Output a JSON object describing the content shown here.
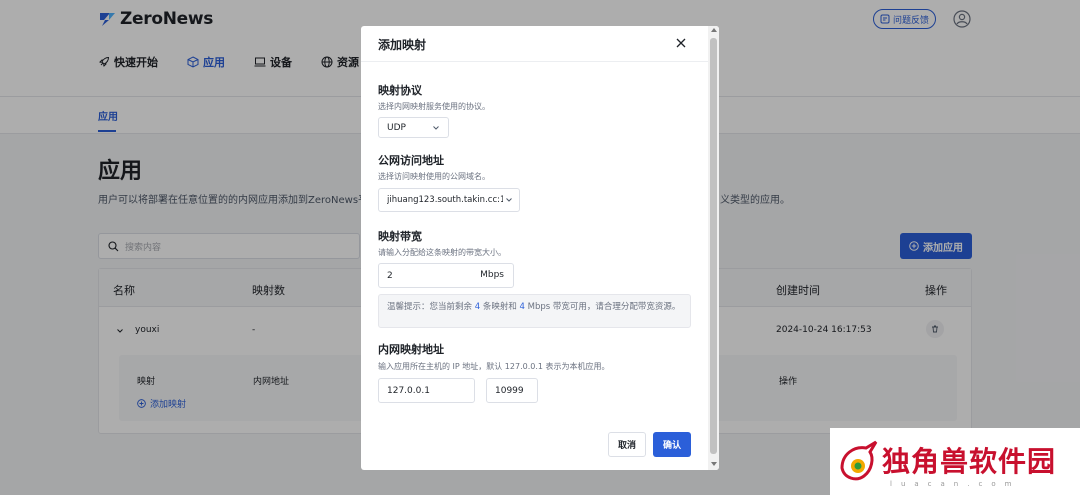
{
  "app": {
    "logo_text": "ZeroNews",
    "feedback_label": "问题反馈",
    "nav": [
      {
        "label": "快速开始",
        "icon": "rocket-icon"
      },
      {
        "label": "应用",
        "icon": "cube-icon",
        "active": true
      },
      {
        "label": "设备",
        "icon": "monitor-icon"
      },
      {
        "label": "资源",
        "icon": "globe-icon"
      }
    ],
    "subtab": "应用",
    "page_title": "应用",
    "page_desc": "用户可以将部署在任意位置的的内网应用添加到ZeroNews平",
    "page_desc_tail": "义类型的应用。",
    "search_placeholder": "搜索内容",
    "add_app_label": "添加应用",
    "table": {
      "headers": {
        "name": "名称",
        "count": "映射数",
        "created": "创建时间",
        "action": "操作"
      },
      "row": {
        "name": "youxi",
        "count": "-",
        "created": "2024-10-24 16:17:53"
      },
      "sub_headers": {
        "map": "映射",
        "inner": "内网地址",
        "action": "操作"
      },
      "add_mapping_label": "添加映射"
    },
    "accent_color": "#2b5fd9"
  },
  "modal": {
    "title": "添加映射",
    "protocol": {
      "label": "映射协议",
      "desc": "选择内网映射服务使用的协议。",
      "value": "UDP"
    },
    "public": {
      "label": "公网访问地址",
      "desc": "选择访问映射使用的公网域名。",
      "value": "jihuang123.south.takin.cc:10("
    },
    "bandwidth": {
      "label": "映射带宽",
      "desc": "请输入分配给这条映射的带宽大小。",
      "value": "2",
      "unit": "Mbps"
    },
    "hint": {
      "prefix": "温馨提示：您当前剩余 ",
      "mappings": "4",
      "mid": " 条映射和 ",
      "bandwidth": "4",
      "suffix": " Mbps 带宽可用，请合理分配带宽资源。"
    },
    "inner": {
      "label": "内网映射地址",
      "desc": "输入应用所在主机的 IP 地址，默认 127.0.0.1 表示为本机应用。",
      "ip": "127.0.0.1",
      "port": "10999"
    },
    "cancel_label": "取消",
    "confirm_label": "确认"
  },
  "watermark": {
    "text": "独角兽软件园",
    "sub": "luacan.com"
  }
}
